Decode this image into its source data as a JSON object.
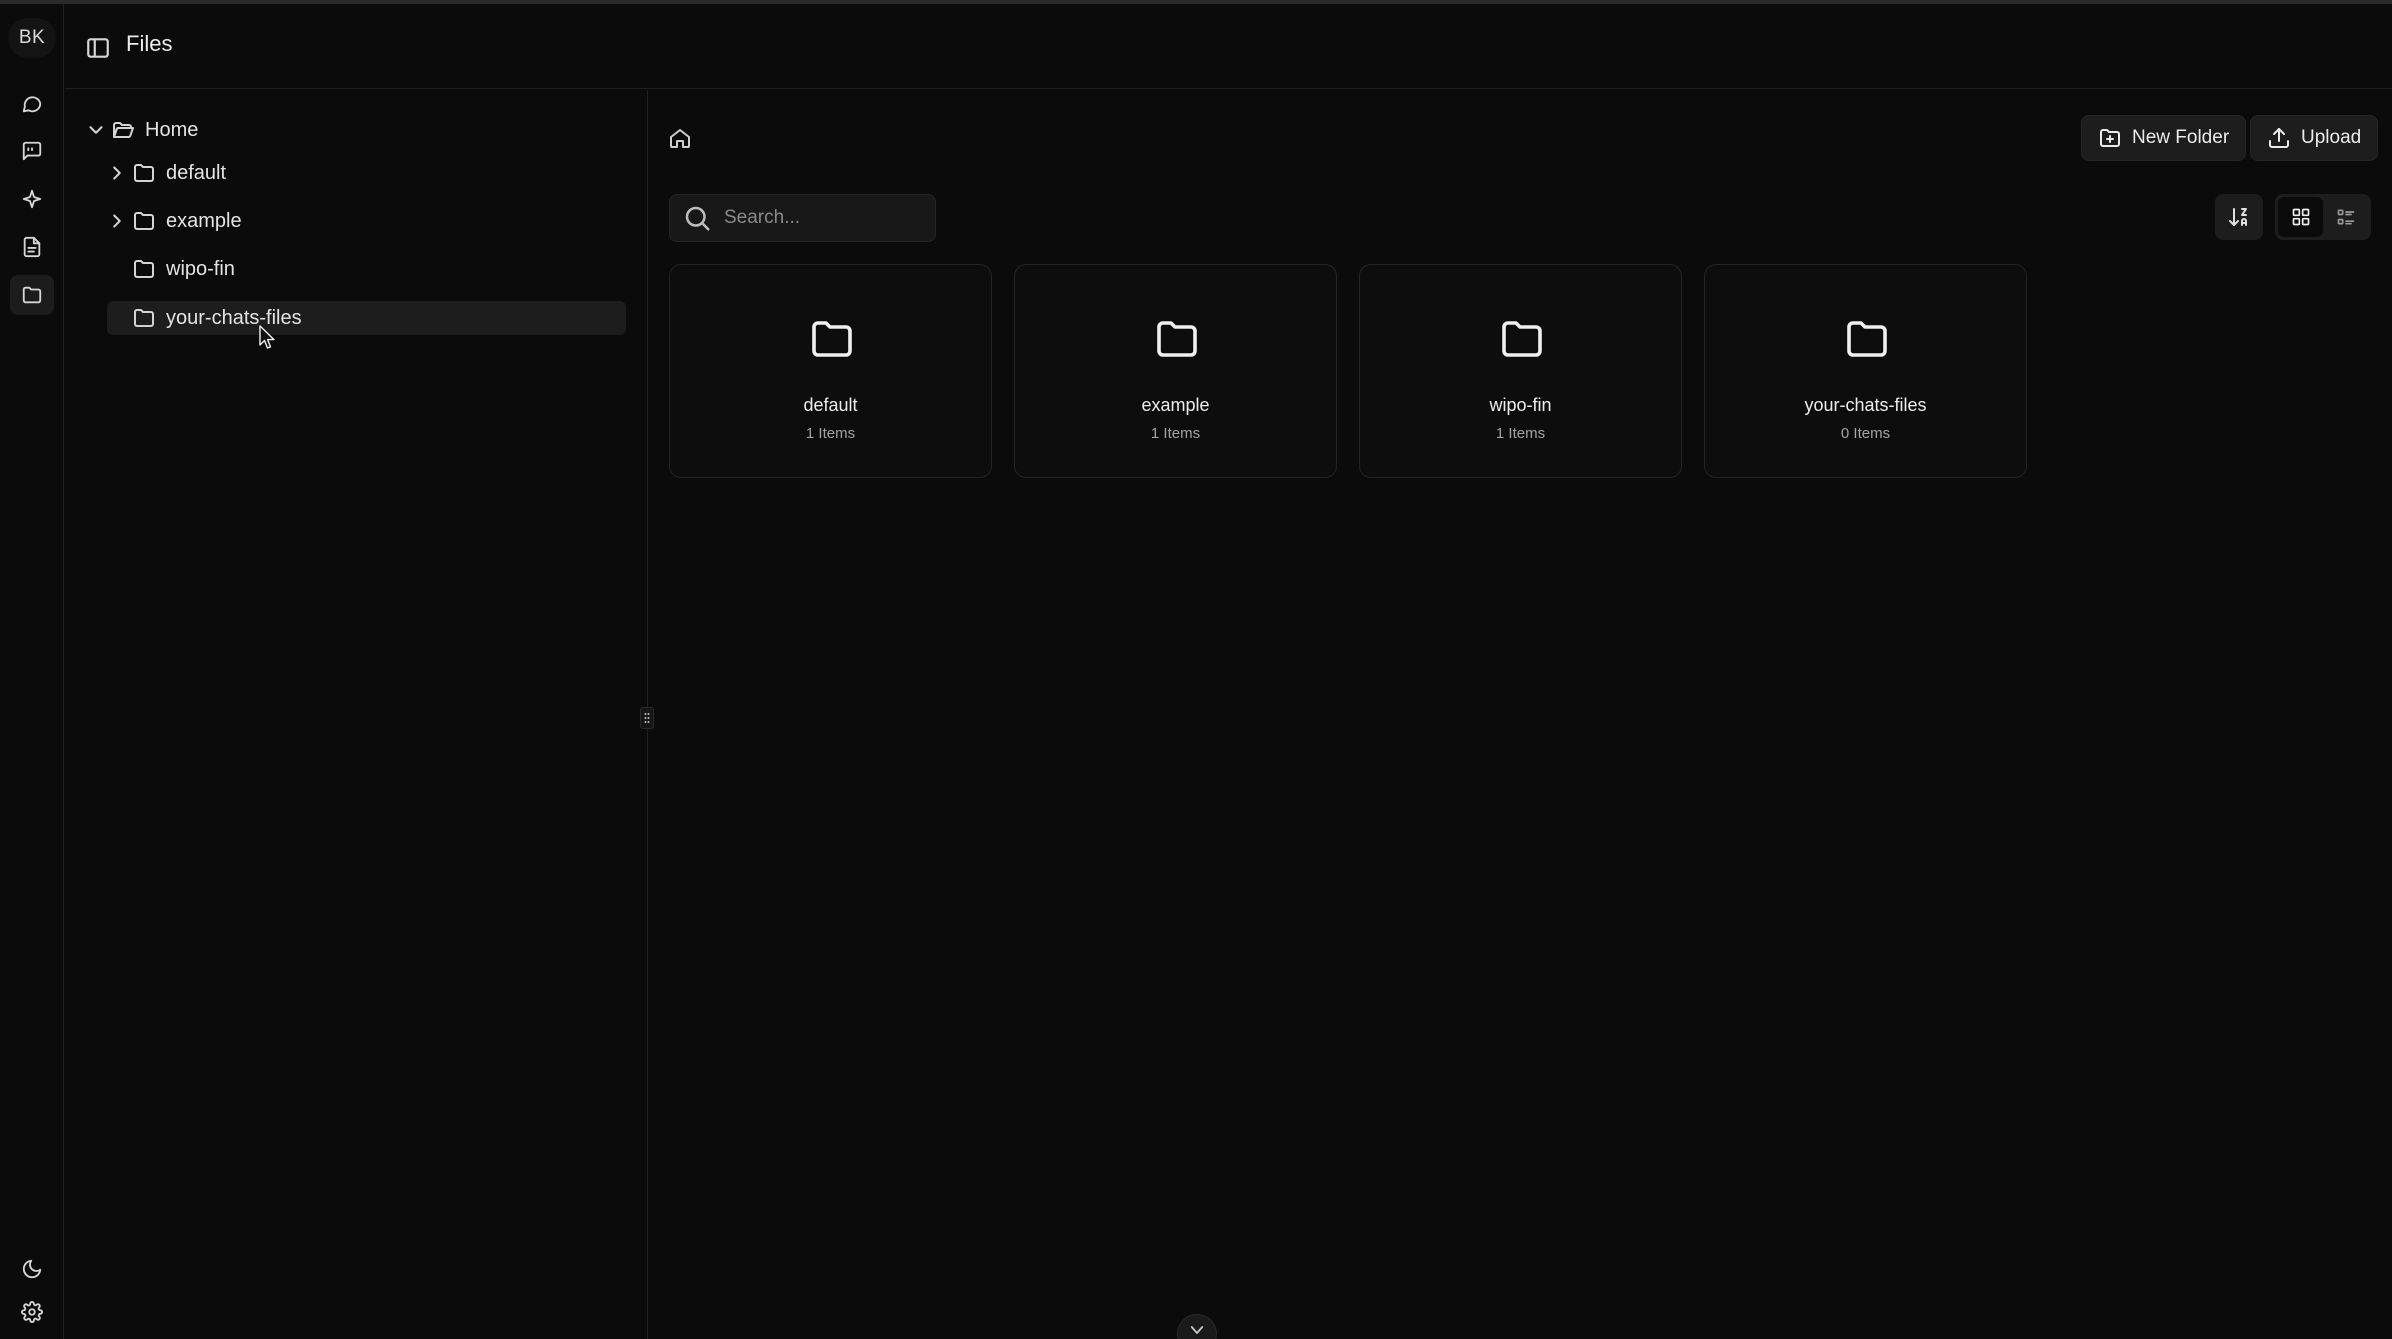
{
  "user": {
    "initials": "BK"
  },
  "header": {
    "title": "Files"
  },
  "tree": {
    "root": "Home",
    "items": [
      {
        "label": "default",
        "expandable": true,
        "selected": false
      },
      {
        "label": "example",
        "expandable": true,
        "selected": false
      },
      {
        "label": "wipo-fin",
        "expandable": false,
        "selected": false
      },
      {
        "label": "your-chats-files",
        "expandable": false,
        "selected": true
      }
    ]
  },
  "toolbar": {
    "new_folder_label": "New Folder",
    "upload_label": "Upload",
    "search_placeholder": "Search..."
  },
  "view": {
    "mode": "grid"
  },
  "folders": [
    {
      "name": "default",
      "count": "1 Items"
    },
    {
      "name": "example",
      "count": "1 Items"
    },
    {
      "name": "wipo-fin",
      "count": "1 Items"
    },
    {
      "name": "your-chats-files",
      "count": "0 Items"
    }
  ],
  "icons": {
    "rail": [
      "chat-icon",
      "message-square-icon",
      "sparkle-icon",
      "document-icon",
      "folder-icon",
      "moon-icon",
      "gear-icon"
    ]
  },
  "colors": {
    "background": "#0b0b0b",
    "panel": "#1d1d1d",
    "border": "#242424",
    "text": "#ececec"
  }
}
